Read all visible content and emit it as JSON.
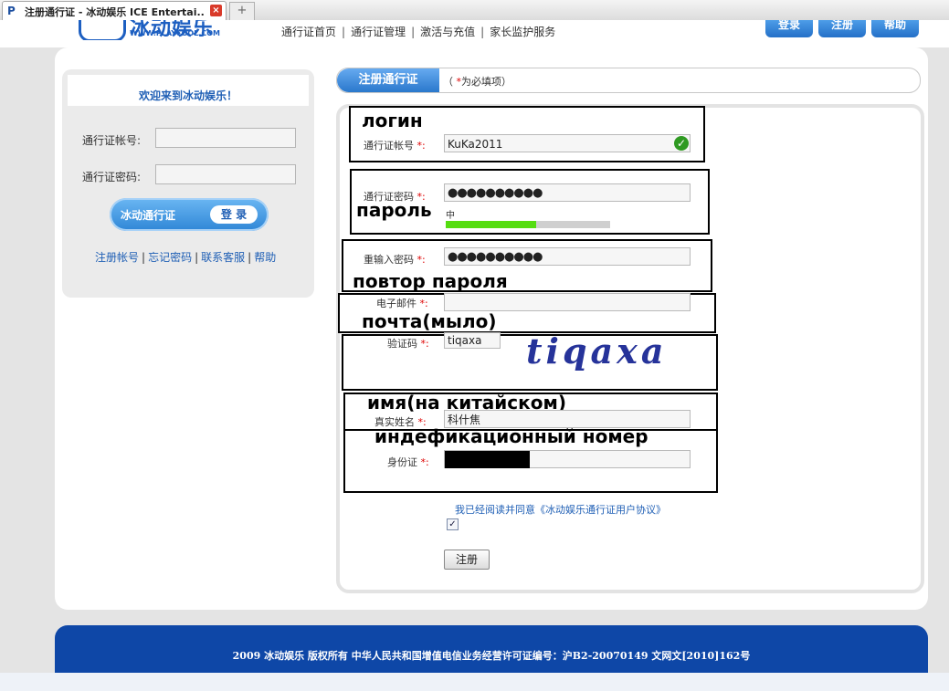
{
  "browser": {
    "tab_title": "注册通行证 - 冰动娱乐 ICE Entertai...",
    "tab_icon": "site-favicon",
    "close_glyph": "×",
    "new_tab_glyph": "+"
  },
  "header": {
    "logo_text": "冰动娱乐",
    "logo_url": "WWW.PLAYCOOL.COM",
    "nav": [
      "通行证首页",
      "通行证管理",
      "激活与充值",
      "家长监护服务"
    ],
    "separator": "|",
    "buttons": [
      "登录",
      "注册",
      "帮助"
    ]
  },
  "login": {
    "welcome": "欢迎来到冰动娱乐！",
    "account_label": "通行证帐号:",
    "password_label": "通行证密码:",
    "button_brand": "冰动通行证",
    "button_action": "登 录",
    "links": [
      "注册帐号",
      "忘记密码",
      "联系客服",
      "帮助"
    ]
  },
  "register": {
    "tab_label": "注册通行证",
    "required_note_prefix": "（ ",
    "required_note_star": "*",
    "required_note_suffix": "为必填项）",
    "required_star": "*:",
    "optional_colon": ":",
    "fields": {
      "account": {
        "label": "通行证帐号",
        "value": "KuKa2011"
      },
      "password": {
        "label": "通行证密码",
        "value": "●●●●●●●●●●",
        "strength_word": "中",
        "strength_fraction": 0.55
      },
      "password_repeat": {
        "label": "重输入密码",
        "value": "●●●●●●●●●●"
      },
      "email": {
        "label": "电子邮件",
        "value": ""
      },
      "captcha": {
        "label": "验证码",
        "value": "tiqaxa",
        "image_text": "tiqaxa"
      },
      "real_name": {
        "label": "真实姓名",
        "value": "科什焦"
      },
      "id_number": {
        "label": "身份证",
        "value": ""
      }
    },
    "agreement": "我已经阅读并同意《冰动娱乐通行证用户协议》",
    "agreement_checked": true,
    "check_glyph": "✓",
    "submit": "注册"
  },
  "annotations": {
    "login": "логин",
    "password": "пароль",
    "password_repeat": "повтор пароля",
    "email": "почта(мыло)",
    "real_name": "имя(на китайском)",
    "id_number": "индефикационный номер"
  },
  "footer": {
    "text": "2009 冰动娱乐 版权所有 中华人民共和国增值电信业务经营许可证编号：沪B2-20070149 文网文[2010]162号"
  },
  "colors": {
    "brand_blue": "#1f5fb5",
    "footer_blue": "#0e47a7",
    "required_red": "#d00000",
    "ok_green": "#2f9a22"
  }
}
